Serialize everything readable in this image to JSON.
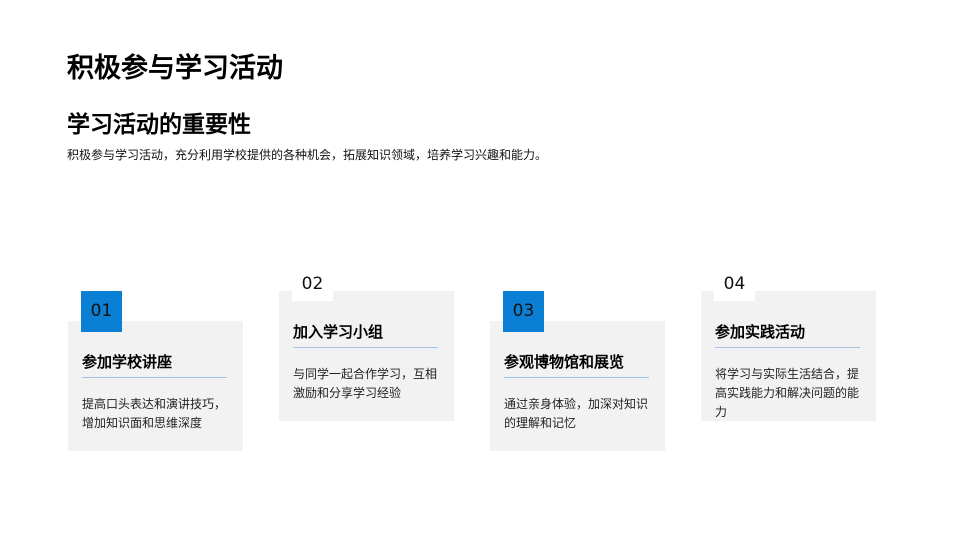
{
  "page": {
    "title": "积极参与学习活动",
    "subtitle": "学习活动的重要性",
    "intro": "积极参与学习活动，充分利用学校提供的各种机会，拓展知识领域，培养学习兴趣和能力。"
  },
  "colors": {
    "accent": "#0a7fd4",
    "card_background": "#f2f2f2",
    "rule": "#9ec3e6"
  },
  "cards": [
    {
      "number": "01",
      "title": "参加学校讲座",
      "description": "提高口头表达和演讲技巧，增加知识面和思维深度"
    },
    {
      "number": "02",
      "title": "加入学习小组",
      "description": "与同学一起合作学习，互相激励和分享学习经验"
    },
    {
      "number": "03",
      "title": "参观博物馆和展览",
      "description": "通过亲身体验，加深对知识的理解和记忆"
    },
    {
      "number": "04",
      "title": "参加实践活动",
      "description": "将学习与实际生活结合，提高实践能力和解决问题的能力"
    }
  ]
}
